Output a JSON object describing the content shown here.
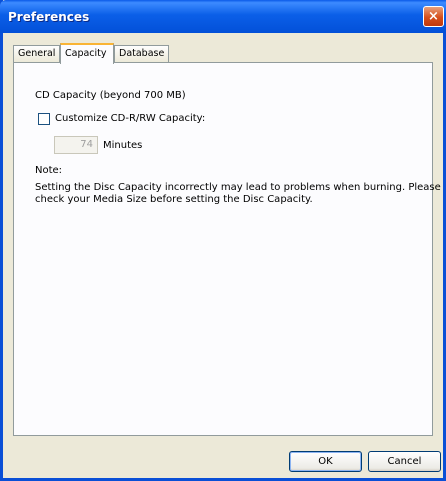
{
  "window": {
    "title": "Preferences",
    "close_glyph": "×"
  },
  "tabs": [
    {
      "label": "General",
      "active": false
    },
    {
      "label": "Capacity",
      "active": true
    },
    {
      "label": "Database",
      "active": false
    }
  ],
  "capacity": {
    "heading": "CD Capacity (beyond 700 MB)",
    "customize_label": "Customize CD-R/RW Capacity:",
    "customize_checked": false,
    "minutes_value": "74",
    "minutes_label": "Minutes",
    "note_label": "Note:",
    "note_line1": "Setting the Disc Capacity incorrectly may lead to problems when burning. Please",
    "note_line2": "check your Media Size before setting the Disc Capacity."
  },
  "buttons": {
    "ok": "OK",
    "cancel": "Cancel"
  },
  "icons": {
    "close": "close-icon"
  },
  "colors": {
    "titlebar": "#0b5fe8",
    "close": "#d64f1c",
    "face": "#ece9d8",
    "tab_highlight": "#f9b434"
  }
}
